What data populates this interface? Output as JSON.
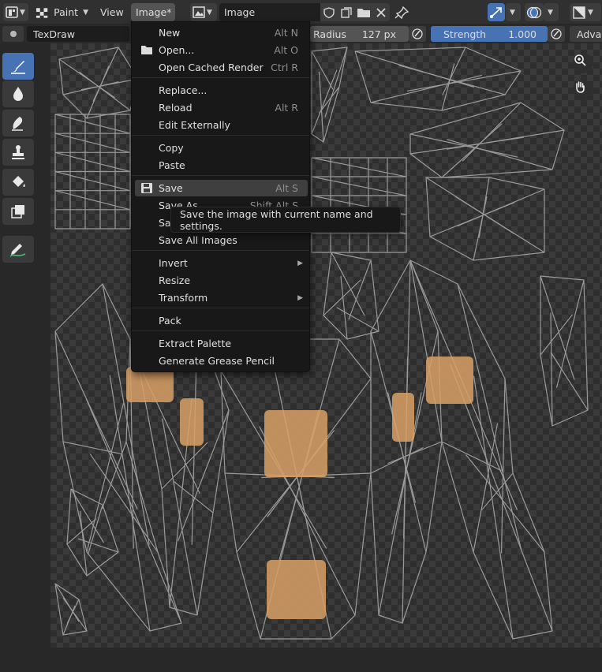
{
  "header": {
    "mode_label": "Paint",
    "view_label": "View",
    "image_menu_label": "Image*",
    "image_name": "Image"
  },
  "tool_settings": {
    "tool_name": "TexDraw",
    "radius_label": "Radius",
    "radius_value": "127 px",
    "strength_label": "Strength",
    "strength_value": "1.000",
    "advanced_label": "Advar"
  },
  "tools": [
    {
      "icon": "brush-draw-icon",
      "active": true
    },
    {
      "icon": "soften-drop-icon",
      "active": false
    },
    {
      "icon": "smear-icon",
      "active": false
    },
    {
      "icon": "clone-stamp-icon",
      "active": false
    },
    {
      "icon": "fill-bucket-icon",
      "active": false
    },
    {
      "icon": "mask-icon",
      "active": false
    },
    {
      "icon": "annotate-icon",
      "active": false
    }
  ],
  "image_menu": {
    "items": [
      {
        "label": "New",
        "shortcut": "Alt N"
      },
      {
        "label": "Open...",
        "shortcut": "Alt O",
        "icon": "folder-icon"
      },
      {
        "label": "Open Cached Render",
        "shortcut": "Ctrl R"
      },
      {
        "label": "Replace...",
        "shortcut": ""
      },
      {
        "label": "Reload",
        "shortcut": "Alt R"
      },
      {
        "label": "Edit Externally",
        "shortcut": ""
      },
      {
        "label": "Copy",
        "shortcut": ""
      },
      {
        "label": "Paste",
        "shortcut": ""
      },
      {
        "label": "Save",
        "shortcut": "Alt S",
        "icon": "save-icon",
        "highlighted": true
      },
      {
        "label": "Save As...",
        "shortcut": "Shift Alt S"
      },
      {
        "label": "Save a Copy...",
        "shortcut": ""
      },
      {
        "label": "Save All Images",
        "shortcut": ""
      },
      {
        "label": "Invert",
        "shortcut": "",
        "submenu": true
      },
      {
        "label": "Resize",
        "shortcut": ""
      },
      {
        "label": "Transform",
        "shortcut": "",
        "submenu": true
      },
      {
        "label": "Pack",
        "shortcut": ""
      },
      {
        "label": "Extract Palette",
        "shortcut": ""
      },
      {
        "label": "Generate Grease Pencil",
        "shortcut": ""
      }
    ]
  },
  "tooltip": {
    "text": "Save the image with current name and settings."
  },
  "colors": {
    "accent": "#4772b3",
    "menu_bg": "#181818",
    "header_bg": "#303030",
    "wire": "#9a9a9a",
    "paint": "#d9a066"
  }
}
